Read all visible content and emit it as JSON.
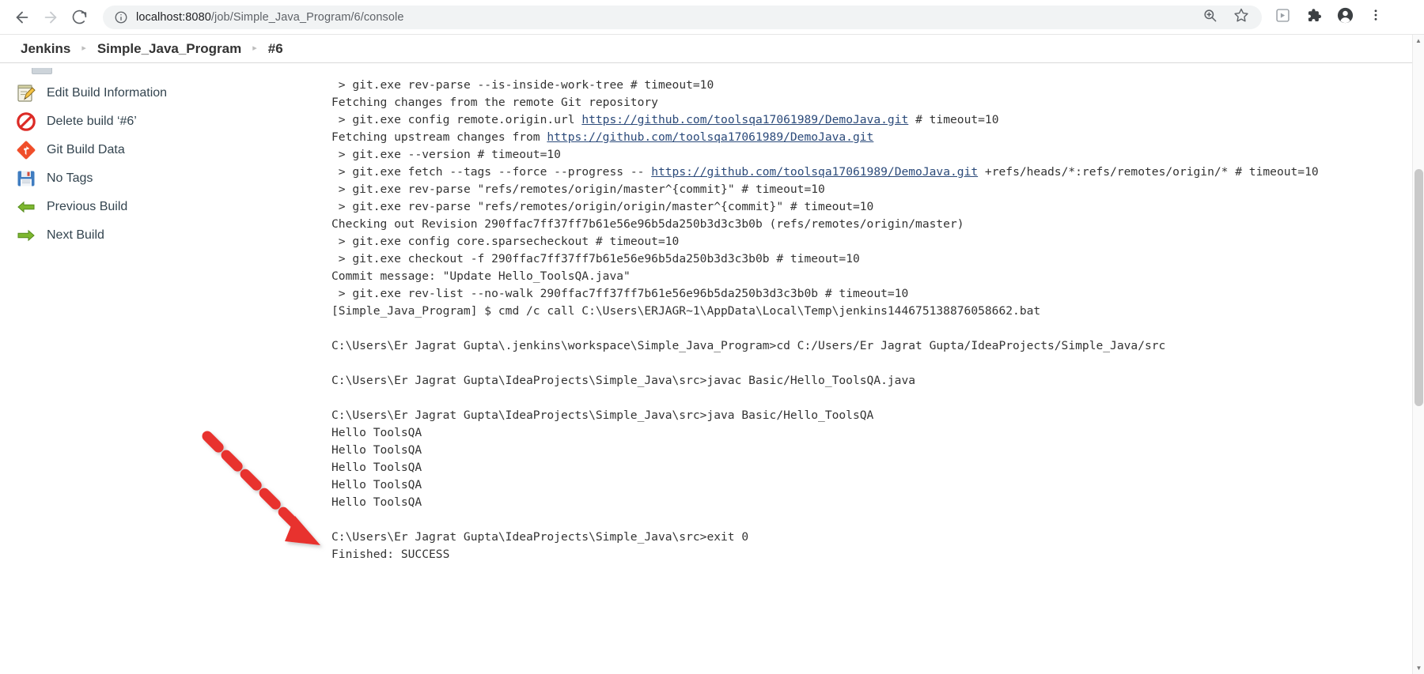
{
  "browser": {
    "back_label": "back-arrow",
    "forward_label": "forward-arrow",
    "reload_label": "reload",
    "site_info_label": "site-information",
    "url_host": "localhost:8080",
    "url_path": "/job/Simple_Java_Program/6/console",
    "url_full": "localhost:8080/job/Simple_Java_Program/6/console",
    "zoom_icon": "zoom-search-icon",
    "bookmark_icon": "star-icon",
    "media_icon": "media-cast-icon",
    "extensions_icon": "puzzle-piece-icon",
    "profile_icon": "account-avatar-icon",
    "menu_icon": "three-dot-menu-icon"
  },
  "breadcrumb": {
    "items": [
      {
        "label": "Jenkins"
      },
      {
        "label": "Simple_Java_Program"
      },
      {
        "label": "#6"
      }
    ],
    "separator": "▸"
  },
  "sidebar": {
    "items": [
      {
        "label": "Edit Build Information",
        "icon": "edit-notepad-icon"
      },
      {
        "label": "Delete build ‘#6’",
        "icon": "delete-forbidden-icon"
      },
      {
        "label": "Git Build Data",
        "icon": "git-diamond-icon"
      },
      {
        "label": "No Tags",
        "icon": "floppy-disk-icon"
      },
      {
        "label": "Previous Build",
        "icon": "green-arrow-left-icon"
      },
      {
        "label": "Next Build",
        "icon": "green-arrow-right-icon"
      }
    ]
  },
  "console": {
    "lines": [
      {
        "text": " > git.exe rev-parse --is-inside-work-tree # timeout=10"
      },
      {
        "text": "Fetching changes from the remote Git repository"
      },
      {
        "pre": " > git.exe config remote.origin.url ",
        "link": "https://github.com/toolsqa17061989/DemoJava.git",
        "post": " # timeout=10"
      },
      {
        "pre": "Fetching upstream changes from ",
        "link": "https://github.com/toolsqa17061989/DemoJava.git",
        "post": ""
      },
      {
        "text": " > git.exe --version # timeout=10"
      },
      {
        "pre": " > git.exe fetch --tags --force --progress -- ",
        "link": "https://github.com/toolsqa17061989/DemoJava.git",
        "post": " +refs/heads/*:refs/remotes/origin/* # timeout=10"
      },
      {
        "text": " > git.exe rev-parse \"refs/remotes/origin/master^{commit}\" # timeout=10"
      },
      {
        "text": " > git.exe rev-parse \"refs/remotes/origin/origin/master^{commit}\" # timeout=10"
      },
      {
        "text": "Checking out Revision 290ffac7ff37ff7b61e56e96b5da250b3d3c3b0b (refs/remotes/origin/master)"
      },
      {
        "text": " > git.exe config core.sparsecheckout # timeout=10"
      },
      {
        "text": " > git.exe checkout -f 290ffac7ff37ff7b61e56e96b5da250b3d3c3b0b # timeout=10"
      },
      {
        "text": "Commit message: \"Update Hello_ToolsQA.java\""
      },
      {
        "text": " > git.exe rev-list --no-walk 290ffac7ff37ff7b61e56e96b5da250b3d3c3b0b # timeout=10"
      },
      {
        "text": "[Simple_Java_Program] $ cmd /c call C:\\Users\\ERJAGR~1\\AppData\\Local\\Temp\\jenkins144675138876058662.bat"
      },
      {
        "text": ""
      },
      {
        "text": "C:\\Users\\Er Jagrat Gupta\\.jenkins\\workspace\\Simple_Java_Program>cd C:/Users/Er Jagrat Gupta/IdeaProjects/Simple_Java/src"
      },
      {
        "text": ""
      },
      {
        "text": "C:\\Users\\Er Jagrat Gupta\\IdeaProjects\\Simple_Java\\src>javac Basic/Hello_ToolsQA.java"
      },
      {
        "text": ""
      },
      {
        "text": "C:\\Users\\Er Jagrat Gupta\\IdeaProjects\\Simple_Java\\src>java Basic/Hello_ToolsQA"
      },
      {
        "text": "Hello ToolsQA"
      },
      {
        "text": "Hello ToolsQA"
      },
      {
        "text": "Hello ToolsQA"
      },
      {
        "text": "Hello ToolsQA"
      },
      {
        "text": "Hello ToolsQA"
      },
      {
        "text": ""
      },
      {
        "text": "C:\\Users\\Er Jagrat Gupta\\IdeaProjects\\Simple_Java\\src>exit 0"
      },
      {
        "text": "Finished: SUCCESS"
      }
    ]
  },
  "annotation": {
    "arrow_color": "#e8322e",
    "arrow_name": "red-dashed-arrow-pointing-to-exit-line"
  },
  "colors": {
    "link": "#2b4a7a",
    "text": "#333333",
    "omnibox_bg": "#f1f3f4",
    "accent_red": "#e8322e",
    "green_arrow": "#7db72f"
  }
}
